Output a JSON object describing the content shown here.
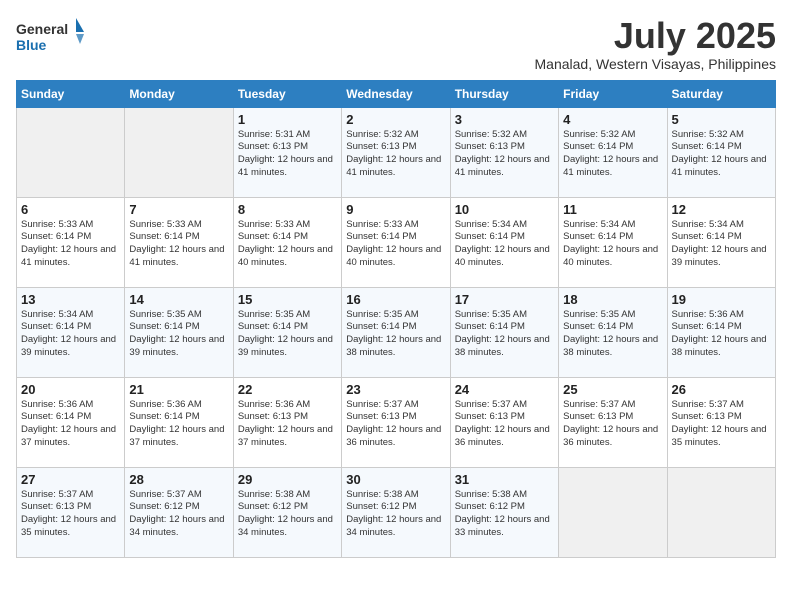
{
  "header": {
    "logo_general": "General",
    "logo_blue": "Blue",
    "title": "July 2025",
    "subtitle": "Manalad, Western Visayas, Philippines"
  },
  "weekdays": [
    "Sunday",
    "Monday",
    "Tuesday",
    "Wednesday",
    "Thursday",
    "Friday",
    "Saturday"
  ],
  "weeks": [
    [
      {
        "day": "",
        "info": ""
      },
      {
        "day": "",
        "info": ""
      },
      {
        "day": "1",
        "info": "Sunrise: 5:31 AM\nSunset: 6:13 PM\nDaylight: 12 hours and 41 minutes."
      },
      {
        "day": "2",
        "info": "Sunrise: 5:32 AM\nSunset: 6:13 PM\nDaylight: 12 hours and 41 minutes."
      },
      {
        "day": "3",
        "info": "Sunrise: 5:32 AM\nSunset: 6:13 PM\nDaylight: 12 hours and 41 minutes."
      },
      {
        "day": "4",
        "info": "Sunrise: 5:32 AM\nSunset: 6:14 PM\nDaylight: 12 hours and 41 minutes."
      },
      {
        "day": "5",
        "info": "Sunrise: 5:32 AM\nSunset: 6:14 PM\nDaylight: 12 hours and 41 minutes."
      }
    ],
    [
      {
        "day": "6",
        "info": "Sunrise: 5:33 AM\nSunset: 6:14 PM\nDaylight: 12 hours and 41 minutes."
      },
      {
        "day": "7",
        "info": "Sunrise: 5:33 AM\nSunset: 6:14 PM\nDaylight: 12 hours and 41 minutes."
      },
      {
        "day": "8",
        "info": "Sunrise: 5:33 AM\nSunset: 6:14 PM\nDaylight: 12 hours and 40 minutes."
      },
      {
        "day": "9",
        "info": "Sunrise: 5:33 AM\nSunset: 6:14 PM\nDaylight: 12 hours and 40 minutes."
      },
      {
        "day": "10",
        "info": "Sunrise: 5:34 AM\nSunset: 6:14 PM\nDaylight: 12 hours and 40 minutes."
      },
      {
        "day": "11",
        "info": "Sunrise: 5:34 AM\nSunset: 6:14 PM\nDaylight: 12 hours and 40 minutes."
      },
      {
        "day": "12",
        "info": "Sunrise: 5:34 AM\nSunset: 6:14 PM\nDaylight: 12 hours and 39 minutes."
      }
    ],
    [
      {
        "day": "13",
        "info": "Sunrise: 5:34 AM\nSunset: 6:14 PM\nDaylight: 12 hours and 39 minutes."
      },
      {
        "day": "14",
        "info": "Sunrise: 5:35 AM\nSunset: 6:14 PM\nDaylight: 12 hours and 39 minutes."
      },
      {
        "day": "15",
        "info": "Sunrise: 5:35 AM\nSunset: 6:14 PM\nDaylight: 12 hours and 39 minutes."
      },
      {
        "day": "16",
        "info": "Sunrise: 5:35 AM\nSunset: 6:14 PM\nDaylight: 12 hours and 38 minutes."
      },
      {
        "day": "17",
        "info": "Sunrise: 5:35 AM\nSunset: 6:14 PM\nDaylight: 12 hours and 38 minutes."
      },
      {
        "day": "18",
        "info": "Sunrise: 5:35 AM\nSunset: 6:14 PM\nDaylight: 12 hours and 38 minutes."
      },
      {
        "day": "19",
        "info": "Sunrise: 5:36 AM\nSunset: 6:14 PM\nDaylight: 12 hours and 38 minutes."
      }
    ],
    [
      {
        "day": "20",
        "info": "Sunrise: 5:36 AM\nSunset: 6:14 PM\nDaylight: 12 hours and 37 minutes."
      },
      {
        "day": "21",
        "info": "Sunrise: 5:36 AM\nSunset: 6:14 PM\nDaylight: 12 hours and 37 minutes."
      },
      {
        "day": "22",
        "info": "Sunrise: 5:36 AM\nSunset: 6:13 PM\nDaylight: 12 hours and 37 minutes."
      },
      {
        "day": "23",
        "info": "Sunrise: 5:37 AM\nSunset: 6:13 PM\nDaylight: 12 hours and 36 minutes."
      },
      {
        "day": "24",
        "info": "Sunrise: 5:37 AM\nSunset: 6:13 PM\nDaylight: 12 hours and 36 minutes."
      },
      {
        "day": "25",
        "info": "Sunrise: 5:37 AM\nSunset: 6:13 PM\nDaylight: 12 hours and 36 minutes."
      },
      {
        "day": "26",
        "info": "Sunrise: 5:37 AM\nSunset: 6:13 PM\nDaylight: 12 hours and 35 minutes."
      }
    ],
    [
      {
        "day": "27",
        "info": "Sunrise: 5:37 AM\nSunset: 6:13 PM\nDaylight: 12 hours and 35 minutes."
      },
      {
        "day": "28",
        "info": "Sunrise: 5:37 AM\nSunset: 6:12 PM\nDaylight: 12 hours and 34 minutes."
      },
      {
        "day": "29",
        "info": "Sunrise: 5:38 AM\nSunset: 6:12 PM\nDaylight: 12 hours and 34 minutes."
      },
      {
        "day": "30",
        "info": "Sunrise: 5:38 AM\nSunset: 6:12 PM\nDaylight: 12 hours and 34 minutes."
      },
      {
        "day": "31",
        "info": "Sunrise: 5:38 AM\nSunset: 6:12 PM\nDaylight: 12 hours and 33 minutes."
      },
      {
        "day": "",
        "info": ""
      },
      {
        "day": "",
        "info": ""
      }
    ]
  ]
}
